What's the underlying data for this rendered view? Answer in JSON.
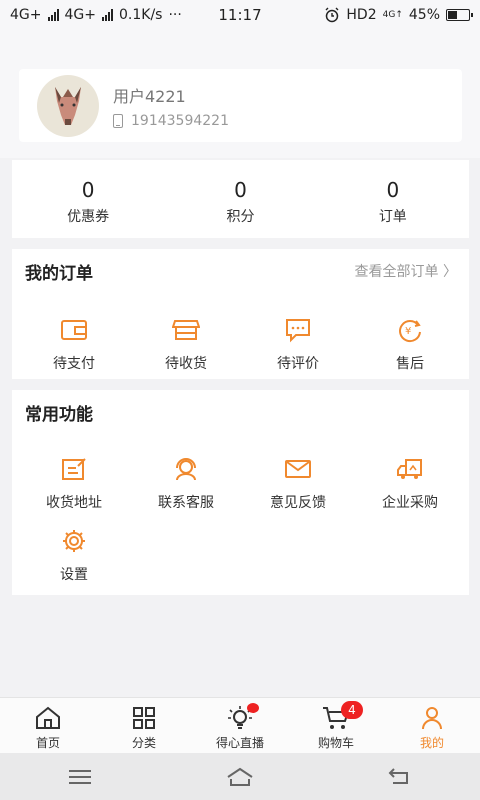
{
  "status_bar": {
    "network1": "4G+",
    "network2": "4G+",
    "speed": "0.1K/s",
    "dots": "···",
    "time": "11:17",
    "hd": "HD2",
    "net_small": "4G↑",
    "battery": "45%"
  },
  "profile": {
    "username": "用户4221",
    "phone": "19143594221"
  },
  "stats": [
    {
      "value": "0",
      "label": "优惠券"
    },
    {
      "value": "0",
      "label": "积分"
    },
    {
      "value": "0",
      "label": "订单"
    }
  ],
  "orders": {
    "title": "我的订单",
    "view_all": "查看全部订单 〉",
    "items": [
      {
        "label": "待支付",
        "icon": "wallet-icon"
      },
      {
        "label": "待收货",
        "icon": "store-icon"
      },
      {
        "label": "待评价",
        "icon": "comment-icon"
      },
      {
        "label": "售后",
        "icon": "refund-icon"
      }
    ]
  },
  "features": {
    "title": "常用功能",
    "items": [
      {
        "label": "收货地址",
        "icon": "edit-address-icon"
      },
      {
        "label": "联系客服",
        "icon": "customer-service-icon"
      },
      {
        "label": "意见反馈",
        "icon": "mail-icon"
      },
      {
        "label": "企业采购",
        "icon": "truck-icon"
      },
      {
        "label": "设置",
        "icon": "gear-icon"
      }
    ]
  },
  "tabbar": {
    "items": [
      {
        "label": "首页",
        "icon": "home-icon"
      },
      {
        "label": "分类",
        "icon": "grid-icon"
      },
      {
        "label": "得心直播",
        "icon": "bulb-icon"
      },
      {
        "label": "购物车",
        "icon": "cart-icon",
        "badge": "4"
      },
      {
        "label": "我的",
        "icon": "user-icon"
      }
    ]
  },
  "colors": {
    "accent": "#f0892e",
    "badge": "#e22222"
  }
}
